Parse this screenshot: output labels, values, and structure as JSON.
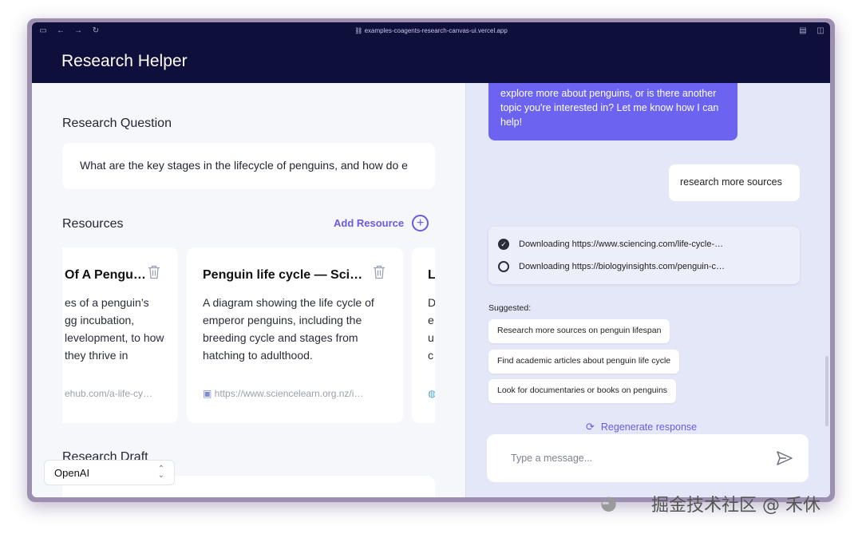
{
  "browser": {
    "url": "examples-coagents-research-canvas-ui.vercel.app"
  },
  "header": {
    "title": "Research Helper"
  },
  "research_question": {
    "title": "Research Question",
    "value": "What are the key stages in the lifecycle of penguins, and how do e"
  },
  "resources": {
    "title": "Resources",
    "add_label": "Add Resource",
    "items": [
      {
        "title": "Of A Pengui…",
        "description": "es of a penguin’s gg incubation, levelopment, to how they thrive in",
        "link": "ehub.com/a-life-cy…"
      },
      {
        "title": "Penguin life cycle — Sci…",
        "description": "A diagram showing the life cycle of emperor penguins, including the breeding cycle and stages from hatching to adulthood.",
        "link": "https://www.sciencelearn.org.nz/i…"
      },
      {
        "title": "L",
        "description": "D e u c",
        "link": ""
      }
    ]
  },
  "draft": {
    "title": "Research Draft"
  },
  "provider": {
    "selected": "OpenAI"
  },
  "chat": {
    "bot_message": "explore more about penguins, or is there another topic you're interested in? Let me know how I can help!",
    "user_message": "research more sources",
    "status": [
      {
        "text": "Downloading https://www.sciencing.com/life-cycle-…",
        "state": "done"
      },
      {
        "text": "Downloading https://biologyinsights.com/penguin-c…",
        "state": "pending"
      }
    ],
    "suggested_label": "Suggested:",
    "suggestions": [
      "Research more sources on penguin lifespan",
      "Find academic articles about penguin life cycle",
      "Look for documentaries or books on penguins"
    ],
    "regenerate_label": "Regenerate response",
    "input_placeholder": "Type a message..."
  },
  "watermark": {
    "text": "掘金技术社区 @ 禾休"
  },
  "colors": {
    "header_bg": "#0f0f3c",
    "accent": "#6a5ae0",
    "bot_bubble": "#6c63f0",
    "chat_bg": "#e4e7f8"
  }
}
